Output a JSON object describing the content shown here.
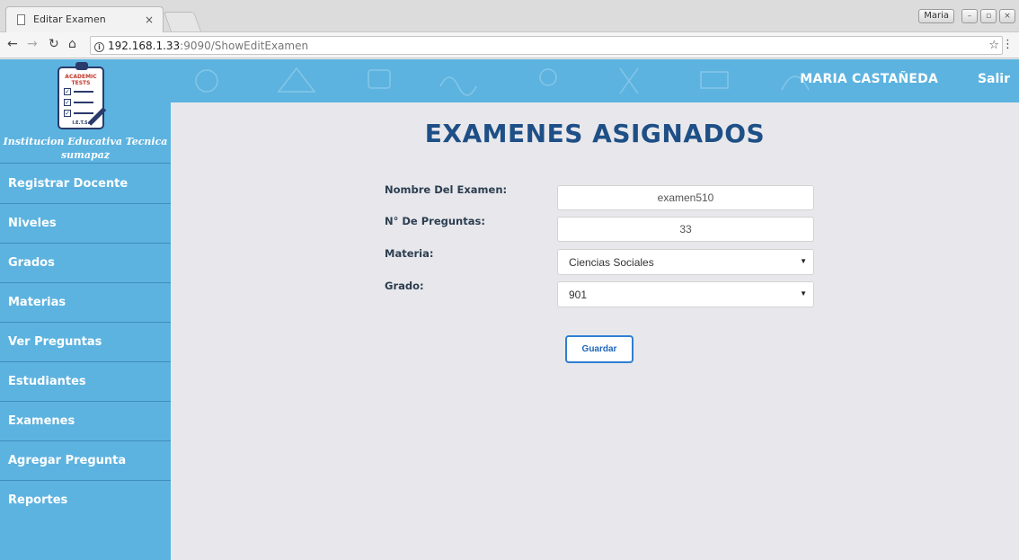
{
  "browser": {
    "tab_title": "Editar Examen",
    "tab_close": "×",
    "user_chip": "Maria",
    "url_host": "192.168.1.33",
    "url_rest": ":9090/ShowEditExamen"
  },
  "header": {
    "user_name": "MARIA CASTAÑEDA",
    "logout_label": "Salir"
  },
  "sidebar": {
    "logo_brand": "ACADEMIC TESTS",
    "logo_footer": "I.E.T.S.",
    "school_line1": "Institucion Educativa Tecnica",
    "school_line2": "sumapaz",
    "items": [
      {
        "label": "Registrar Docente"
      },
      {
        "label": "Niveles"
      },
      {
        "label": "Grados"
      },
      {
        "label": "Materias"
      },
      {
        "label": "Ver Preguntas"
      },
      {
        "label": "Estudiantes"
      },
      {
        "label": "Examenes"
      },
      {
        "label": "Agregar Pregunta"
      },
      {
        "label": "Reportes"
      }
    ]
  },
  "main": {
    "title": "EXAMENES ASIGNADOS",
    "fields": {
      "nombre": {
        "label": "Nombre Del Examen:",
        "value": "examen510"
      },
      "preguntas": {
        "label": "N° De Preguntas:",
        "value": "33"
      },
      "materia": {
        "label": "Materia:",
        "value": "Ciencias Sociales"
      },
      "grado": {
        "label": "Grado:",
        "value": "901"
      }
    },
    "save_label": "Guardar"
  },
  "colors": {
    "primary": "#5cb3e0",
    "title": "#1e4f86",
    "button_border": "#2f7fd1"
  }
}
